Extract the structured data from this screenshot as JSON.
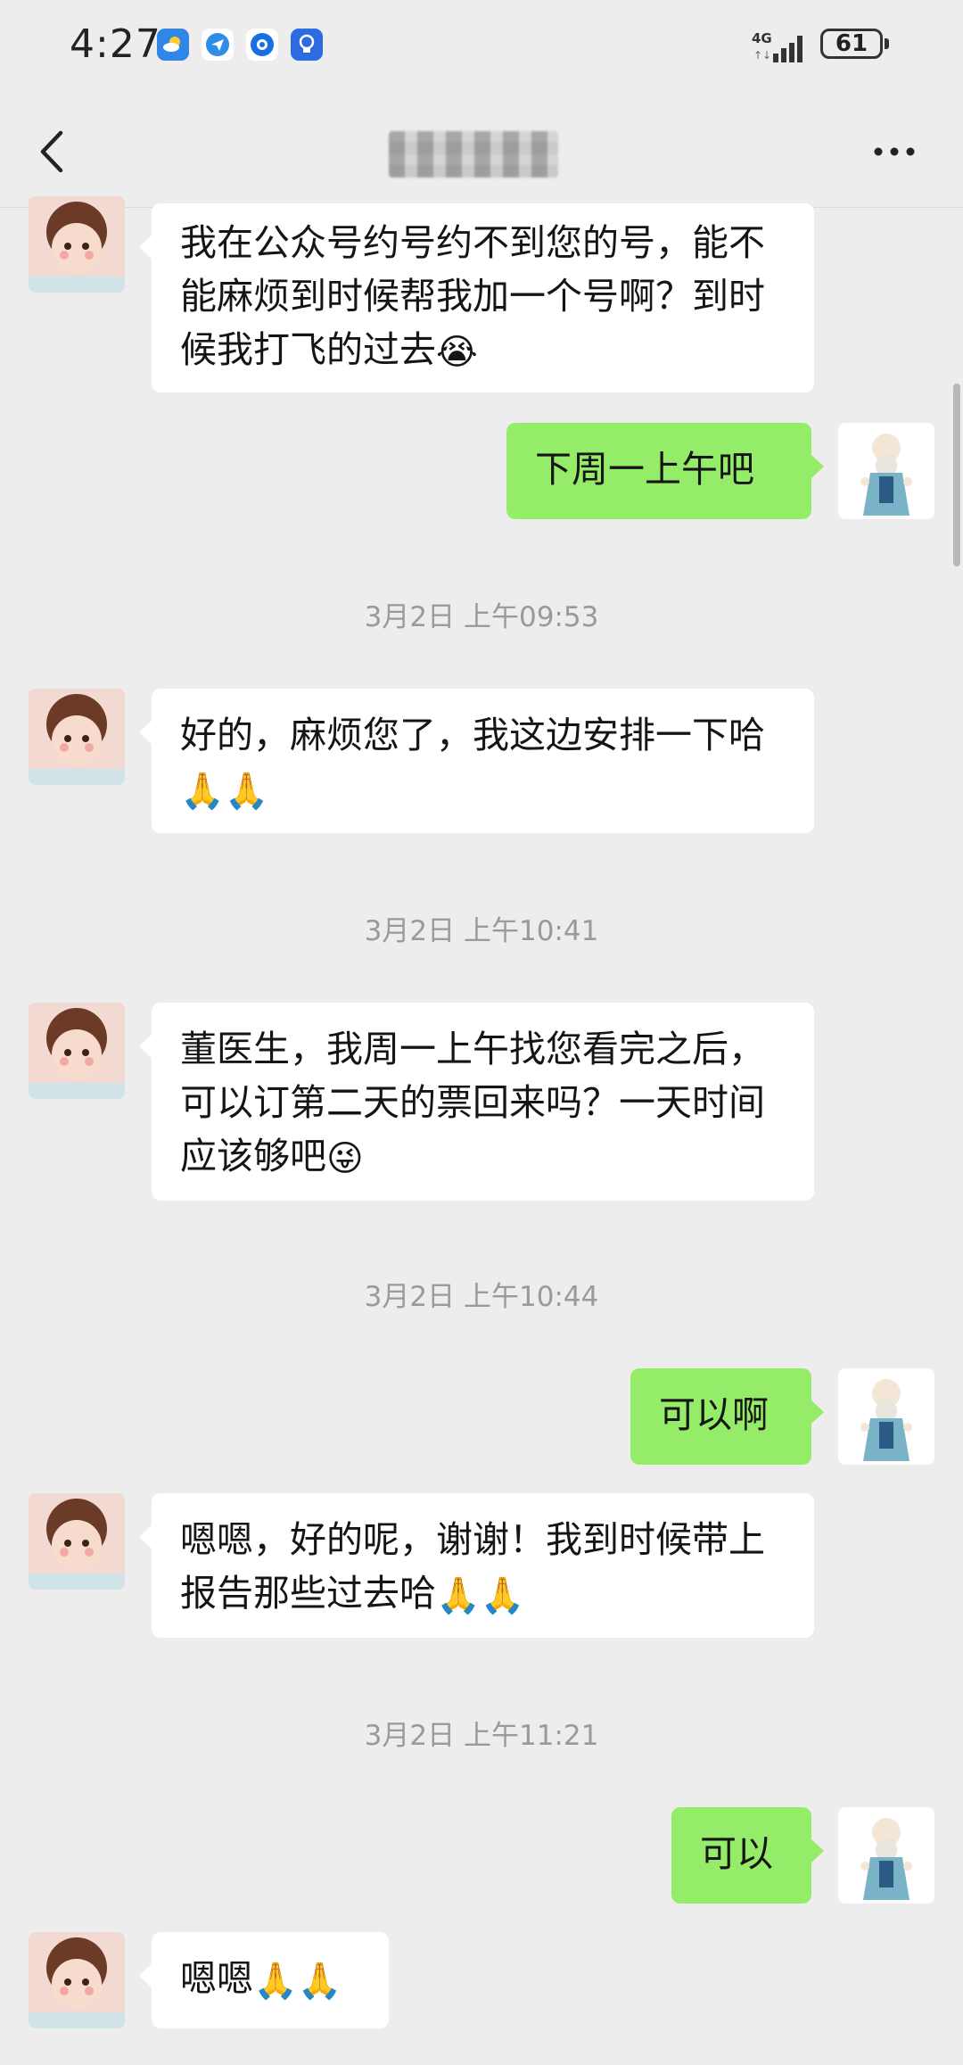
{
  "status_bar": {
    "time": "4:27",
    "network": "4G",
    "battery": "61"
  },
  "header": {
    "back_icon": "chevron-left-icon",
    "title": "",
    "more_icon": "more-dots-icon"
  },
  "colors": {
    "background": "#ededed",
    "incoming_bubble": "#ffffff",
    "outgoing_bubble": "#95ec69",
    "timestamp": "#9a9a9a"
  },
  "messages": [
    {
      "side": "in",
      "text": "我在公众号约号约不到您的号，能不能麻烦到时候帮我加一个号啊？到时候我打飞的过去",
      "emoji": "😭"
    },
    {
      "side": "out",
      "text": "下周一上午吧"
    },
    {
      "timestamp": "3月2日 上午09:53"
    },
    {
      "side": "in",
      "text": "好的，麻烦您了，我这边安排一下哈",
      "emoji": "🙏🙏"
    },
    {
      "timestamp": "3月2日 上午10:41"
    },
    {
      "side": "in",
      "text": "董医生，我周一上午找您看完之后，可以订第二天的票回来吗？一天时间应该够吧",
      "emoji": "😜"
    },
    {
      "timestamp": "3月2日 上午10:44"
    },
    {
      "side": "out",
      "text": "可以啊"
    },
    {
      "side": "in",
      "text": "嗯嗯，好的呢，谢谢！我到时候带上报告那些过去哈",
      "emoji": "🙏🙏"
    },
    {
      "timestamp": "3月2日 上午11:21"
    },
    {
      "side": "out",
      "text": "可以"
    },
    {
      "side": "in",
      "text": "嗯嗯",
      "emoji": "🙏🙏"
    }
  ]
}
